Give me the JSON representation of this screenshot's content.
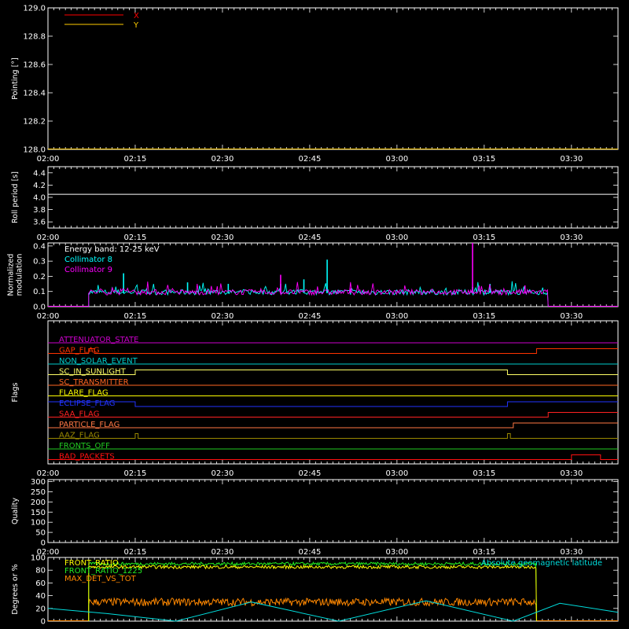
{
  "chart_data": [
    {
      "id": "pointing",
      "type": "line",
      "ylabel": "Pointing [°]",
      "ylim": [
        128.0,
        129.0
      ],
      "yticks": [
        "128.0",
        "128.2",
        "128.4",
        "128.6",
        "128.8",
        "129.0"
      ],
      "xlim": [
        "02:00",
        "03:38"
      ],
      "xticks": [
        "02:00",
        "02:15",
        "02:30",
        "02:45",
        "03:00",
        "03:15",
        "03:30"
      ],
      "series": [
        {
          "name": "X",
          "color": "#ff0000"
        },
        {
          "name": "Y",
          "color": "#ffcc00",
          "values": [
            128.0
          ]
        }
      ]
    },
    {
      "id": "roll_period",
      "type": "line",
      "ylabel": "Roll period [s]",
      "ylim": [
        3.5,
        4.5
      ],
      "yticks": [
        "3.6",
        "3.8",
        "4.0",
        "4.2",
        "4.4"
      ],
      "xticks": [
        "02:00",
        "02:15",
        "02:30",
        "02:45",
        "03:00",
        "03:15",
        "03:30"
      ],
      "series": [
        {
          "color": "#ffffff",
          "values": [
            4.05
          ]
        }
      ]
    },
    {
      "id": "modulation",
      "type": "line",
      "ylabel": [
        "Normalized",
        "modulation"
      ],
      "ylim": [
        0,
        0.42
      ],
      "yticks": [
        "0.0",
        "0.1",
        "0.2",
        "0.3",
        "0.4"
      ],
      "xticks": [
        "02:00",
        "02:15",
        "02:30",
        "02:45",
        "03:00",
        "03:15",
        "03:30"
      ],
      "annotation": "Energy band: 12-25 keV",
      "active_interval": [
        "02:07",
        "03:26"
      ],
      "baseline": 0.09,
      "series": [
        {
          "name": "Collimator 8",
          "color": "#00ffff",
          "spikes": [
            [
              "02:13",
              0.22
            ],
            [
              "02:24",
              0.16
            ],
            [
              "02:31",
              0.15
            ],
            [
              "02:40",
              0.15
            ],
            [
              "02:44",
              0.18
            ],
            [
              "02:48",
              0.31
            ],
            [
              "03:16",
              0.15
            ],
            [
              "03:13",
              0.13
            ]
          ]
        },
        {
          "name": "Collimator 9",
          "color": "#ff00ff",
          "spikes": [
            [
              "02:40",
              0.21
            ],
            [
              "02:52",
              0.12
            ],
            [
              "03:13",
              0.43
            ],
            [
              "03:22",
              0.14
            ]
          ]
        }
      ]
    },
    {
      "id": "flags",
      "type": "line",
      "ylabel": "Flags",
      "xticks": [
        "02:00",
        "02:15",
        "02:30",
        "02:45",
        "03:00",
        "03:15",
        "03:30"
      ],
      "flags": [
        {
          "name": "ATTENUATOR_STATE",
          "color": "#cc00cc",
          "steps": []
        },
        {
          "name": "GAP_FLAG",
          "color": "#ff3300",
          "steps": [
            [
              "02:00",
              0
            ],
            [
              "02:07",
              1
            ],
            [
              "02:08",
              0
            ],
            [
              "03:24",
              1
            ]
          ]
        },
        {
          "name": "NON_SOLAR_EVENT",
          "color": "#00cccc",
          "steps": []
        },
        {
          "name": "SC_IN_SUNLIGHT",
          "color": "#ffff66",
          "steps": [
            [
              "02:00",
              0
            ],
            [
              "02:15",
              1
            ],
            [
              "03:19",
              0
            ]
          ]
        },
        {
          "name": "SC_TRANSMITTER",
          "color": "#ff6622",
          "steps": []
        },
        {
          "name": "FLARE_FLAG",
          "color": "#ffff00",
          "steps": []
        },
        {
          "name": "ECLIPSE_FLAG",
          "color": "#2233ff",
          "steps": [
            [
              "02:00",
              1
            ],
            [
              "02:15",
              0
            ],
            [
              "03:19",
              1
            ]
          ]
        },
        {
          "name": "SAA_FLAG",
          "color": "#ff2222",
          "steps": [
            [
              "02:00",
              0
            ],
            [
              "03:26",
              1
            ]
          ]
        },
        {
          "name": "PARTICLE_FLAG",
          "color": "#ff7744",
          "steps": [
            [
              "02:00",
              0
            ],
            [
              "03:20",
              1
            ]
          ]
        },
        {
          "name": "AAZ_FLAG",
          "color": "#998800",
          "steps": [
            [
              "02:00",
              0
            ],
            [
              "02:15",
              1
            ],
            [
              "02:15.5",
              0
            ],
            [
              "03:19",
              1
            ],
            [
              "03:19.5",
              0
            ]
          ]
        },
        {
          "name": "FRONTS_OFF",
          "color": "#22cc22",
          "steps": []
        },
        {
          "name": "BAD_PACKETS",
          "color": "#ff1111",
          "steps": [
            [
              "02:00",
              0
            ],
            [
              "03:30",
              1
            ],
            [
              "03:35",
              0
            ]
          ]
        }
      ]
    },
    {
      "id": "quality",
      "type": "line",
      "ylabel": "Quality",
      "ylim": [
        0,
        310
      ],
      "yticks": [
        "0",
        "50",
        "100",
        "150",
        "200",
        "250",
        "300"
      ],
      "xticks": [
        "02:00",
        "02:15",
        "02:30",
        "02:45",
        "03:00",
        "03:15",
        "03:30"
      ],
      "series": []
    },
    {
      "id": "ratios",
      "type": "line",
      "ylabel": "Degrees or %",
      "ylim": [
        0,
        100
      ],
      "yticks": [
        "0",
        "20",
        "40",
        "60",
        "80",
        "100"
      ],
      "xticks": [
        "02:00",
        "02:15",
        "02:30",
        "02:45",
        "03:00",
        "03:15",
        "03:30"
      ],
      "right_label": "Absolute geomagnetic latitude",
      "active_interval": [
        "02:07",
        "03:24"
      ],
      "series": [
        {
          "name": "FRONT_RATIO",
          "color": "#ffff00",
          "level": 85
        },
        {
          "name": "FRONT_RATIO_1225",
          "color": "#22ee22",
          "level": 90
        },
        {
          "name": "MAX_DET_VS_TOT",
          "color": "#ff8800",
          "level": 30
        },
        {
          "name": "Absolute geomagnetic latitude",
          "color": "#00dddd",
          "points": [
            [
              "02:00",
              20
            ],
            [
              "02:10",
              12
            ],
            [
              "02:22",
              0
            ],
            [
              "02:35",
              30
            ],
            [
              "02:50",
              0
            ],
            [
              "03:05",
              32
            ],
            [
              "03:20",
              0
            ],
            [
              "03:28",
              28
            ],
            [
              "03:38",
              14
            ]
          ]
        }
      ]
    }
  ]
}
